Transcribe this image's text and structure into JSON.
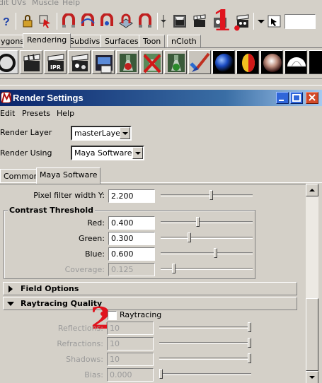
{
  "main_menubar": [
    "dit UVs",
    "Muscle",
    "Help"
  ],
  "shelf_tabs": [
    "ygons",
    "Rendering",
    "Subdivs",
    "Surfaces",
    "Toon",
    "nCloth"
  ],
  "shelf_active_tab": "Rendering",
  "annotations": {
    "one": "1.",
    "two": "2"
  },
  "render_settings": {
    "title": "Render Settings",
    "menu": [
      "Edit",
      "Presets",
      "Help"
    ],
    "render_layer_label": "Render Layer",
    "render_layer_value": "masterLayer",
    "render_using_label": "Render Using",
    "render_using_value": "Maya Software",
    "tabs": [
      "Common",
      "Maya Software"
    ],
    "active_tab": "Maya Software",
    "pixel_filter": {
      "label": "Pixel filter width Y:",
      "value": "2.200",
      "level": 0.55
    },
    "contrast_threshold": {
      "title": "Contrast Threshold",
      "fields": [
        {
          "label": "Red:",
          "value": "0.400",
          "level": 0.4,
          "disabled": false
        },
        {
          "label": "Green:",
          "value": "0.300",
          "level": 0.3,
          "disabled": false
        },
        {
          "label": "Blue:",
          "value": "0.600",
          "level": 0.6,
          "disabled": false
        },
        {
          "label": "Coverage:",
          "value": "0.125",
          "level": 0.125,
          "disabled": true
        }
      ]
    },
    "field_options": {
      "label": "Field Options"
    },
    "raytracing_quality": {
      "label": "Raytracing Quality",
      "checkbox_label": "Raytracing",
      "checked": false,
      "fields": [
        {
          "label": "Reflections:",
          "value": "10",
          "level": 1.0
        },
        {
          "label": "Refractions:",
          "value": "10",
          "level": 1.0
        },
        {
          "label": "Shadows:",
          "value": "10",
          "level": 1.0
        },
        {
          "label": "Bias:",
          "value": "0.000",
          "level": 0.0
        }
      ]
    }
  }
}
